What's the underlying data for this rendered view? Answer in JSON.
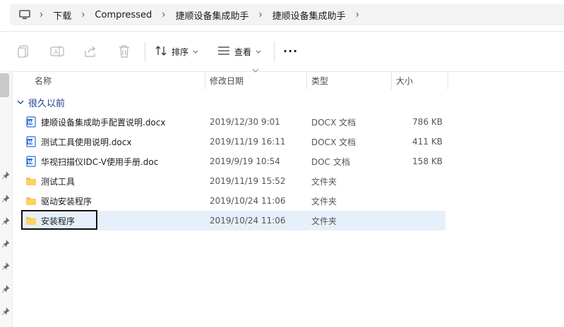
{
  "breadcrumb": {
    "items": [
      "下载",
      "Compressed",
      "捷顺设备集成助手",
      "捷顺设备集成助手"
    ]
  },
  "toolbar": {
    "sort_label": "排序",
    "view_label": "查看",
    "more_label": "···"
  },
  "columns": {
    "name": "名称",
    "modified": "修改日期",
    "type": "类型",
    "size": "大小"
  },
  "group": {
    "label": "很久以前"
  },
  "files": [
    {
      "name": "捷顺设备集成助手配置说明.docx",
      "modified": "2019/12/30 9:01",
      "type": "DOCX 文档",
      "size": "786 KB",
      "icon": "word-doc-icon"
    },
    {
      "name": "测试工具使用说明.docx",
      "modified": "2019/11/19 16:11",
      "type": "DOCX 文档",
      "size": "411 KB",
      "icon": "word-doc-icon"
    },
    {
      "name": "华视扫描仪IDC-V使用手册.doc",
      "modified": "2019/9/19 10:54",
      "type": "DOC 文档",
      "size": "158 KB",
      "icon": "word-doc-icon"
    },
    {
      "name": "测试工具",
      "modified": "2019/11/19 15:52",
      "type": "文件夹",
      "size": "",
      "icon": "folder-icon"
    },
    {
      "name": "驱动安装程序",
      "modified": "2019/10/24 11:06",
      "type": "文件夹",
      "size": "",
      "icon": "folder-icon"
    },
    {
      "name": "安装程序",
      "modified": "2019/10/24 11:06",
      "type": "文件夹",
      "size": "",
      "icon": "folder-icon",
      "selected": true
    }
  ],
  "colors": {
    "accent": "#1c3f8f",
    "selection": "#e6f0fb",
    "folder": "#f8c54a",
    "word": "#2b6fd6"
  }
}
